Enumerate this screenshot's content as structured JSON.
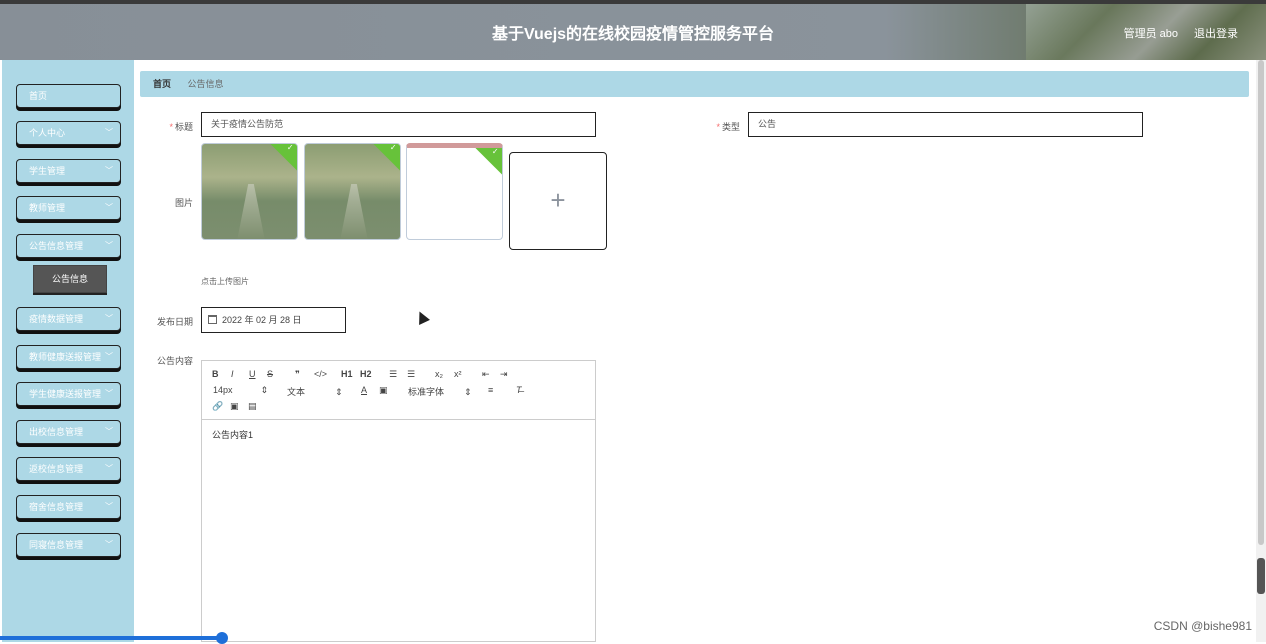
{
  "header": {
    "title": "基于Vuejs的在线校园疫情管控服务平台",
    "user": "管理员 abo",
    "logout": "退出登录"
  },
  "sidebar": {
    "items": [
      {
        "label": "首页",
        "chevron": false
      },
      {
        "label": "个人中心",
        "chevron": true
      },
      {
        "label": "学生管理",
        "chevron": true
      },
      {
        "label": "教师管理",
        "chevron": true
      },
      {
        "label": "公告信息管理",
        "chevron": true
      },
      {
        "label": "疫情数据管理",
        "chevron": true
      },
      {
        "label": "教师健康送报管理",
        "chevron": true
      },
      {
        "label": "学生健康送报管理",
        "chevron": true
      },
      {
        "label": "出校信息管理",
        "chevron": true
      },
      {
        "label": "返校信息管理",
        "chevron": true
      },
      {
        "label": "宿舍信息管理",
        "chevron": true
      },
      {
        "label": "同寝信息管理",
        "chevron": true
      }
    ],
    "sub_item": "公告信息"
  },
  "breadcrumb": {
    "home": "首页",
    "current": "公告信息"
  },
  "form": {
    "title_label": "标题",
    "title_value": "关于疫情公告防范",
    "type_label": "类型",
    "type_value": "公告",
    "image_label": "图片",
    "upload_hint": "点击上传图片",
    "date_label": "发布日期",
    "date_value": "2022 年 02 月 28 日",
    "content_label": "公告内容",
    "content_value": "公告内容1"
  },
  "editor_toolbar": {
    "font_size": "14px",
    "heading_select": "文本",
    "font_family": "标准字体",
    "buttons": [
      "B",
      "I",
      "U",
      "S",
      "❞",
      "</>",
      "H1",
      "H2",
      "☰",
      "☰",
      "x₂",
      "x²"
    ]
  },
  "icons": [
    "calendar-icon",
    "plus-icon",
    "check-icon",
    "chevron-down-icon",
    "cursor-icon"
  ],
  "watermark": "CSDN @bishe981",
  "colors": {
    "sidebar": "#add8e6",
    "header": "#8a939b",
    "required": "#f56c6c",
    "success": "#67c23a"
  }
}
